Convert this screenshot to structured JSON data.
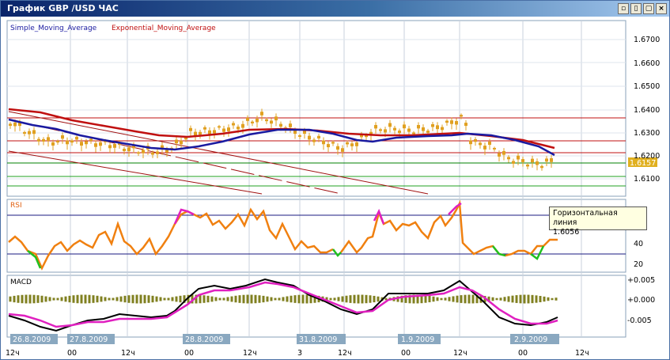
{
  "window": {
    "title": "График GBP /USD  ЧАС",
    "buttons": [
      "▫",
      "▯",
      "▢",
      "×"
    ]
  },
  "legend": {
    "sma": "Simple_Moving_Average",
    "ema": "Exponential_Moving_Average"
  },
  "price_axis": {
    "labels": [
      "1.6700",
      "1.6600",
      "1.6500",
      "1.6400",
      "1.6300",
      "1.6200",
      "1.6100"
    ],
    "current_price": "1.6157"
  },
  "rsi": {
    "label": "RSI",
    "axis_labels": [
      "40",
      "20"
    ]
  },
  "macd": {
    "label": "MACD",
    "axis_labels": [
      "+0.005",
      "+0.000",
      "-0.005"
    ]
  },
  "tooltip": {
    "line1": "Горизонтальная линия",
    "line2": "1.6056"
  },
  "time_axis": {
    "ticks": [
      "12ч",
      "00",
      "12ч",
      "00",
      "12ч",
      "3",
      "12ч",
      "00",
      "12ч",
      "00",
      "12ч"
    ],
    "dates": [
      "26.8.2009",
      "27.8.2009",
      "28.8.2009",
      "31.8.2009",
      "1.9.2009",
      "2.9.2009"
    ]
  },
  "colors": {
    "sma": "#1a1aa0",
    "ema": "#c01010",
    "candle": "#e0a020",
    "rsi_main": "#f08010",
    "rsi_low": "#20c020",
    "rsi_high": "#e020c0",
    "macd_hist": "#808020",
    "macd_signal": "#e020c0",
    "macd_line": "#000000",
    "price_tag": "#e0b020"
  }
}
